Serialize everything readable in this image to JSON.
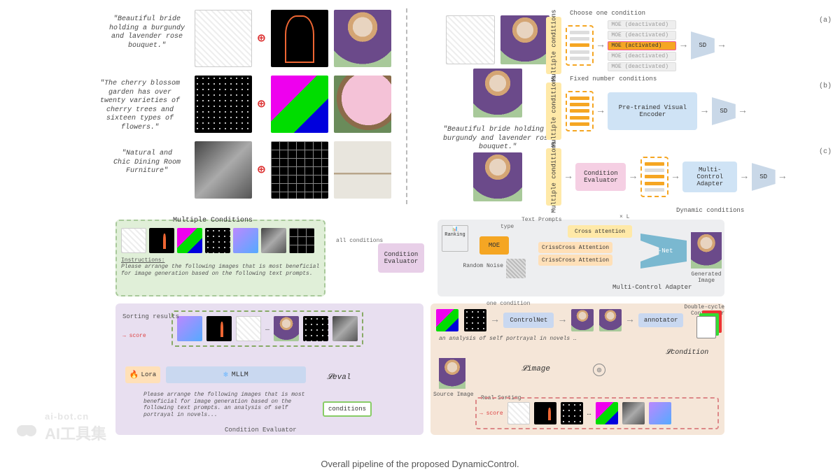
{
  "prompts": {
    "bride": "\"Beautiful bride holding a burgundy and lavender rose bouquet.\"",
    "blossom": "\"The cherry blossom garden has over twenty varieties of cherry trees and sixteen types of flowers.\"",
    "dining": "\"Natural and Chic Dining Room Furniture\"",
    "mid": "\"Beautiful bride holding a burgundy and lavender rose bouquet.\""
  },
  "right": {
    "multiple_conditions": "Multiple conditions",
    "choose_one": "Choose one condition",
    "fixed_number": "Fixed number conditions",
    "dynamic": "Dynamic conditions",
    "moe_deact": "MOE (deactivated)",
    "moe_act": "MOE (activated)",
    "pretrained": "Pre-trained Visual Encoder",
    "cond_eval": "Condition Evaluator",
    "mca": "Multi-Control Adapter",
    "sd": "SD",
    "tags": {
      "a": "(a)",
      "b": "(b)",
      "c": "(c)"
    }
  },
  "bottom": {
    "mc_title": "Multiple Conditions",
    "instructions_label": "Instructions:",
    "instructions_text": "Please arrange the following images that is most beneficial for image generation based on the following text prompts.",
    "all_conditions": "all conditions",
    "cond_eval": "Condition Evaluator",
    "ranking": "Ranking",
    "type": "type",
    "text_prompts": "Text Prompts",
    "xl": "× L",
    "cross_attention": "Cross attention",
    "crisscross": "CrissCross Attention",
    "moe": "MOE",
    "random_noise": "Random Noise",
    "unet": "U-Net",
    "generated": "Generated Image",
    "mca_label": "Multi-Control Adapter",
    "sorting_results": "Sorting\nresults",
    "score": "score",
    "lora": "Lora",
    "mllm": "MLLM",
    "leval": "𝓛eval",
    "arrange_text": "Please arrange the following images that is most beneficial for image generation based on the following text prompts. an analysis of self portrayal in novels...",
    "conditions_btn": "conditions",
    "ce_label": "Condition Evaluator",
    "one_condition": "one condition",
    "controlnet": "ControlNet",
    "annotator": "annotator",
    "analysis_text": "an analysis of self portrayal in novels …",
    "limage": "𝓛image",
    "lcondition": "𝓛condition",
    "source_image": "Source Image",
    "real_sorting": "Real\nSorting",
    "dcc": "Double-cycle Controller"
  },
  "caption": "Overall pipeline of the proposed DynamicControl.",
  "watermark": {
    "url": "ai-bot.cn",
    "name": "AI工具集"
  }
}
